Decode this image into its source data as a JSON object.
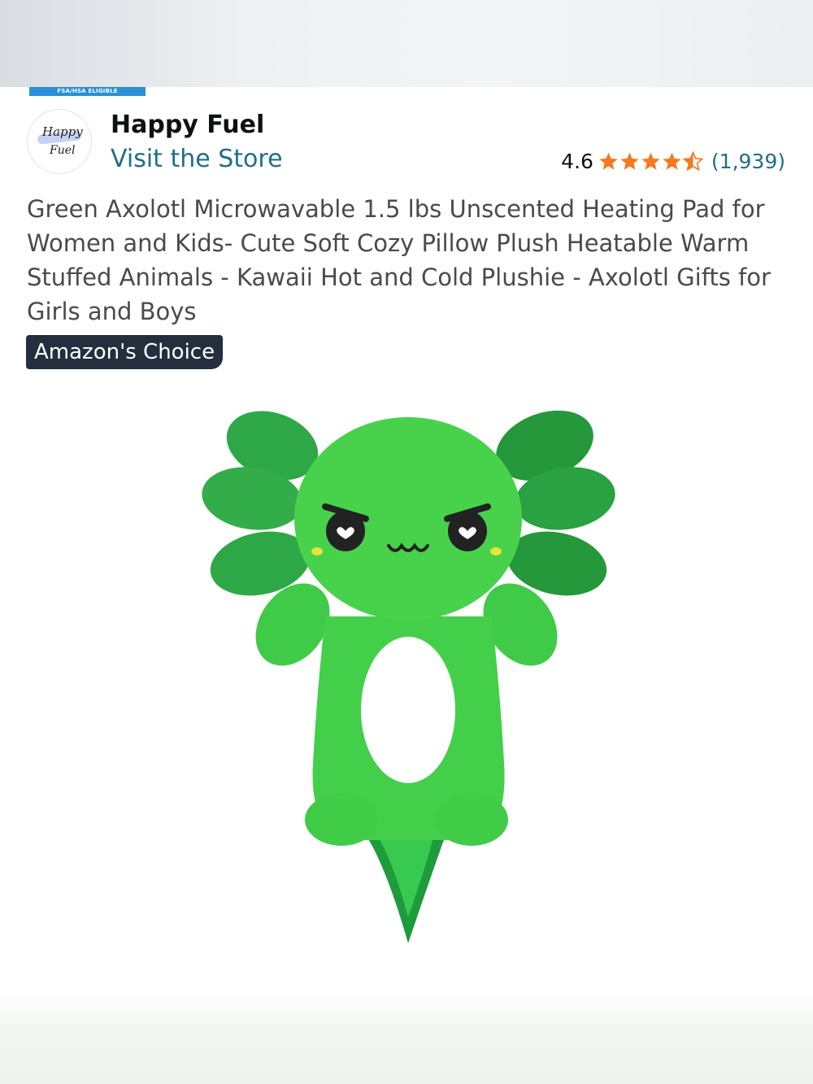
{
  "badge_fsa": "FSA/HSA ELIGIBLE",
  "brand": {
    "logo_line1": "Happy",
    "logo_line2": "Fuel",
    "name": "Happy Fuel",
    "store_link": "Visit the Store"
  },
  "rating": {
    "value": "4.6",
    "stars": 4.6,
    "review_count": "(1,939)"
  },
  "product": {
    "title": "Green Axolotl Microwavable 1.5 lbs Unscented Heating Pad for Women and Kids- Cute Soft Cozy Pillow Plush Heatable Warm Stuffed Animals - Kawaii Hot and Cold Plushie - Axolotl Gifts for Girls and Boys",
    "choice_badge": "Amazon's Choice"
  },
  "colors": {
    "link": "#1f6f88",
    "star": "#f5791f",
    "badge_bg": "#232f3e",
    "fsa_bar": "#2a8fd6"
  }
}
